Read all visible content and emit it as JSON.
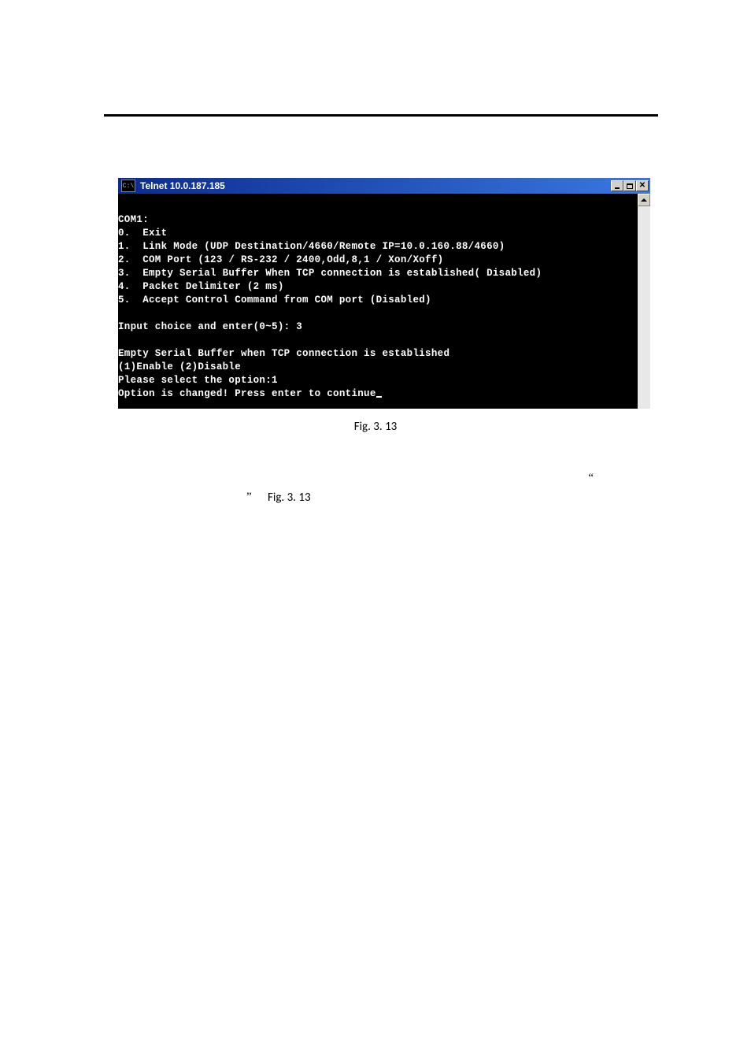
{
  "window": {
    "icon_text": "C:\\",
    "title": "Telnet 10.0.187.185"
  },
  "console": {
    "lines": [
      "",
      "COM1:",
      "0.  Exit",
      "1.  Link Mode (UDP Destination/4660/Remote IP=10.0.160.88/4660)",
      "2.  COM Port (123 / RS-232 / 2400,Odd,8,1 / Xon/Xoff)",
      "3.  Empty Serial Buffer When TCP connection is established( Disabled)",
      "4.  Packet Delimiter (2 ms)",
      "5.  Accept Control Command from COM port (Disabled)",
      "",
      "Input choice and enter(0~5): 3",
      "",
      "Empty Serial Buffer when TCP connection is established",
      "(1)Enable (2)Disable",
      "Please select the option:1",
      "Option is changed! Press enter to continue"
    ]
  },
  "captions": {
    "fig1": "Fig. 3. 13",
    "fig2": "Fig. 3. 13"
  },
  "quotes": {
    "open": "“",
    "close": "”"
  }
}
